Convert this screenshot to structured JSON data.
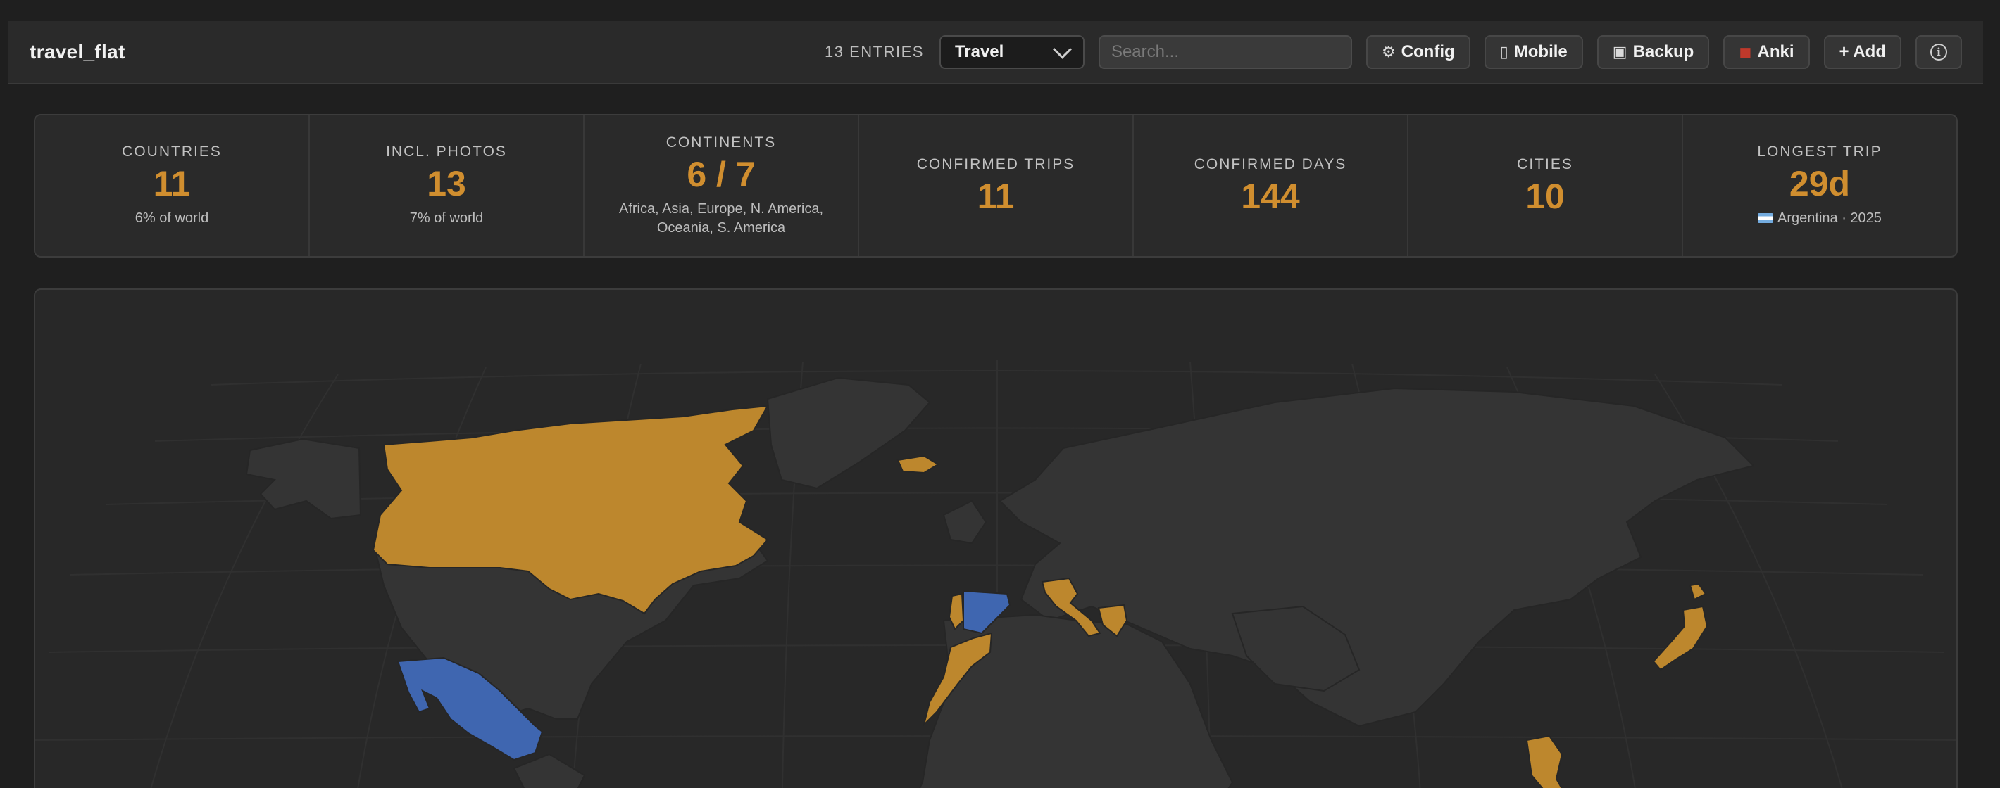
{
  "header": {
    "title": "travel_flat",
    "entries": "13 ENTRIES",
    "category_select": "Travel",
    "search_placeholder": "Search...",
    "buttons": {
      "config": {
        "icon": "gear-icon",
        "glyph": "⚙",
        "label": "Config"
      },
      "mobile": {
        "icon": "phone-icon",
        "glyph": "▯",
        "label": "Mobile"
      },
      "backup": {
        "icon": "floppy-disk-icon",
        "glyph": "▣",
        "label": "Backup"
      },
      "anki": {
        "icon": "flashcard-icon",
        "glyph": "◼",
        "label": "Anki"
      },
      "add": {
        "label": "+ Add"
      },
      "info": {
        "icon": "info-icon",
        "glyph": "i"
      }
    }
  },
  "stats": [
    {
      "label": "COUNTRIES",
      "value": "11",
      "sub": "6% of world"
    },
    {
      "label": "INCL. PHOTOS",
      "value": "13",
      "sub": "7% of world"
    },
    {
      "label": "CONTINENTS",
      "value": "6 / 7",
      "sub": "Africa, Asia, Europe, N. America, Oceania, S. America"
    },
    {
      "label": "CONFIRMED TRIPS",
      "value": "11",
      "sub": ""
    },
    {
      "label": "CONFIRMED DAYS",
      "value": "144",
      "sub": ""
    },
    {
      "label": "CITIES",
      "value": "10",
      "sub": ""
    },
    {
      "label": "LONGEST TRIP",
      "value": "29d",
      "sub": "Argentina · 2025"
    }
  ],
  "colors": {
    "visited": "#bd872d",
    "photos_only": "#3f66b0",
    "land": "#343434",
    "background": "#1f1f1f",
    "accent": "#d08e2f"
  },
  "map": {
    "visited_countries": [
      "Canada",
      "Iceland",
      "Portugal",
      "Italy",
      "Greece",
      "Morocco",
      "Japan",
      "Thailand"
    ],
    "highlighted_countries": [
      "Mexico",
      "Spain"
    ]
  }
}
